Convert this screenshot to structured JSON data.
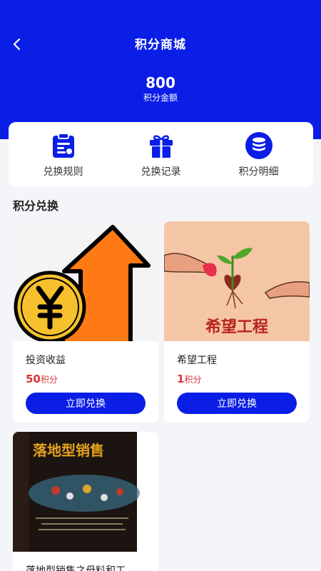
{
  "header": {
    "title": "积分商城",
    "points": "800",
    "points_label": "积分金额"
  },
  "shortcuts": [
    {
      "label": "兑换规则",
      "icon": "clipboard-icon"
    },
    {
      "label": "兑换记录",
      "icon": "gift-icon"
    },
    {
      "label": "积分明细",
      "icon": "coin-stack-icon"
    }
  ],
  "section": {
    "title": "积分兑换"
  },
  "products": [
    {
      "name": "投资收益",
      "points": "50",
      "unit": "积分",
      "button": "立即兑换"
    },
    {
      "name": "希望工程",
      "points": "1",
      "unit": "积分",
      "button": "立即兑换",
      "image_text": "希望工程"
    },
    {
      "name": "落地型销售之母料和工",
      "book_title": "落地型销售"
    }
  ],
  "colors": {
    "brand": "#0a1ee6",
    "price": "#d8343a"
  }
}
